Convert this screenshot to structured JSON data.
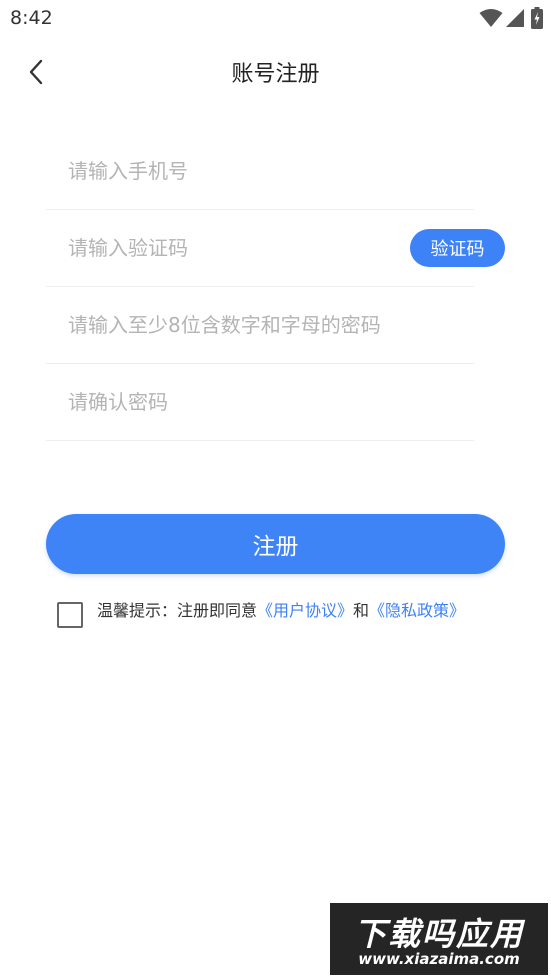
{
  "status_bar": {
    "time": "8:42",
    "icons": [
      "wifi-icon",
      "signal-icon",
      "battery-icon"
    ]
  },
  "header": {
    "back_icon": "chevron-left-icon",
    "title": "账号注册"
  },
  "form": {
    "phone_placeholder": "请输入手机号",
    "code_placeholder": "请输入验证码",
    "code_button_label": "验证码",
    "password_placeholder": "请输入至少8位含数字和字母的密码",
    "confirm_placeholder": "请确认密码"
  },
  "register_button_label": "注册",
  "agreement": {
    "checked": false,
    "prefix": "温馨提示：注册即同意",
    "user_agreement": "《用户协议》",
    "conjunction": "和",
    "privacy_policy": "《隐私政策》"
  },
  "watermark": {
    "main": "下载吗应用",
    "sub": "www.xiazaima.com"
  },
  "colors": {
    "accent": "#3e84f7",
    "link": "#3d82f6",
    "placeholder": "#b4b4b4",
    "divider": "#ededed"
  }
}
